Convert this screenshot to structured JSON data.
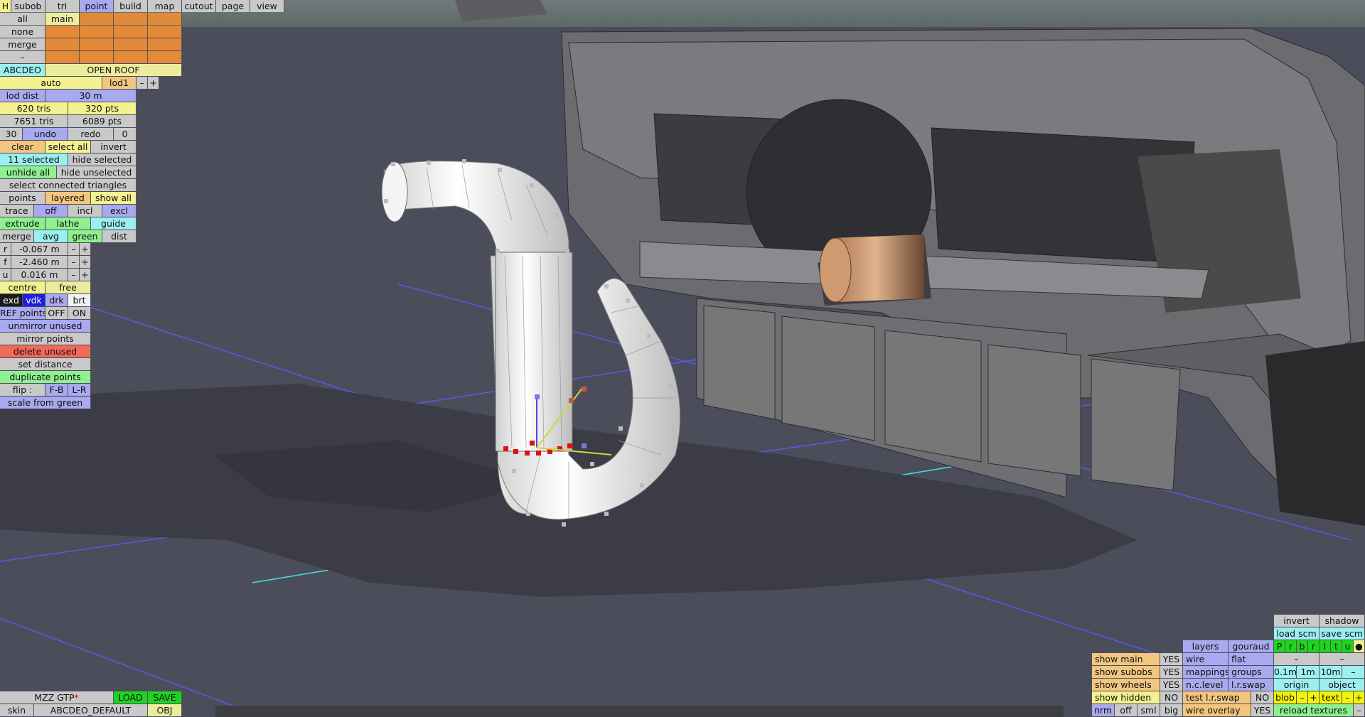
{
  "menu": {
    "first": "H",
    "items": [
      "subob",
      "tri",
      "point",
      "build",
      "map",
      "cutout",
      "page",
      "view"
    ]
  },
  "select": {
    "all": "all",
    "main": "main",
    "none": "none",
    "merge": "merge",
    "dash": "–"
  },
  "object": {
    "code": "ABCDEO",
    "name": "OPEN ROOF"
  },
  "lod": {
    "auto": "auto",
    "level": "lod1",
    "minus": "–",
    "plus": "+",
    "dist_label": "lod dist",
    "dist_value": "30 m"
  },
  "stats": {
    "tris_sel": "620 tris",
    "pts_sel": "320 pts",
    "tris_total": "7651 tris",
    "pts_total": "6089 pts"
  },
  "history": {
    "count": "30",
    "undo": "undo",
    "redo": "redo",
    "redo_count": "0"
  },
  "selection": {
    "clear": "clear",
    "select_all": "select all",
    "invert": "invert",
    "selected": "11 selected",
    "hide_selected": "hide selected",
    "unhide_all": "unhide all",
    "hide_unselected": "hide unselected",
    "connected": "select connected triangles"
  },
  "points": {
    "points": "points",
    "layered": "layered",
    "show_all": "show all",
    "trace": "trace",
    "off": "off",
    "incl": "incl",
    "excl": "excl",
    "extrude": "extrude",
    "lathe": "lathe",
    "guide": "guide",
    "merge": "merge",
    "avg": "avg",
    "green": "green",
    "dist": "dist"
  },
  "coords": {
    "r_label": "r",
    "r_value": "-0.067 m",
    "f_label": "f",
    "f_value": "-2.460 m",
    "u_label": "u",
    "u_value": "0.016 m",
    "minus": "–",
    "plus": "+"
  },
  "tools": {
    "centre": "centre",
    "free": "free",
    "exd": "exd",
    "vdk": "vdk",
    "drk": "drk",
    "brt": "brt",
    "ref_points": "REF points",
    "ref_off": "OFF",
    "ref_on": "ON",
    "unmirror": "unmirror unused",
    "mirror": "mirror points",
    "delete_unused": "delete unused",
    "set_distance": "set distance",
    "duplicate": "duplicate points",
    "flip": "flip :",
    "fb": "F-B",
    "lr": "L-R",
    "scale_green": "scale from green"
  },
  "file": {
    "car": "MZZ GTP",
    "star": "*",
    "load": "LOAD",
    "save": "SAVE",
    "skin": "skin",
    "skin_name": "ABCDEO_DEFAULT",
    "obj": "OBJ"
  },
  "display": {
    "invert": "invert",
    "shadow": "shadow",
    "load_scm": "load scm",
    "save_scm": "save scm",
    "layers": "layers",
    "gouraud": "gouraud",
    "prbrltu": [
      "P",
      "r",
      "b",
      "r",
      "l",
      "t",
      "u"
    ],
    "dot": "●",
    "show_main": "show main",
    "show_subobs": "show subobs",
    "show_wheels": "show wheels",
    "show_hidden": "show hidden",
    "yes": "YES",
    "no": "NO",
    "wire": "wire",
    "flat": "flat",
    "mappings": "mappings",
    "groups": "groups",
    "nc_level": "n.c.level",
    "lr_swap": "l.r.swap",
    "test_lr_swap": "test l.r.swap",
    "wire_overlay": "wire overlay",
    "grid_01": "0.1m",
    "grid_1": "1m",
    "grid_10": "10m",
    "origin": "origin",
    "object": "object",
    "blob": "blob",
    "text": "text",
    "nrm": "nrm",
    "off": "off",
    "sml": "sml",
    "big": "big",
    "reload": "reload textures",
    "dash": "–",
    "plus": "+"
  }
}
